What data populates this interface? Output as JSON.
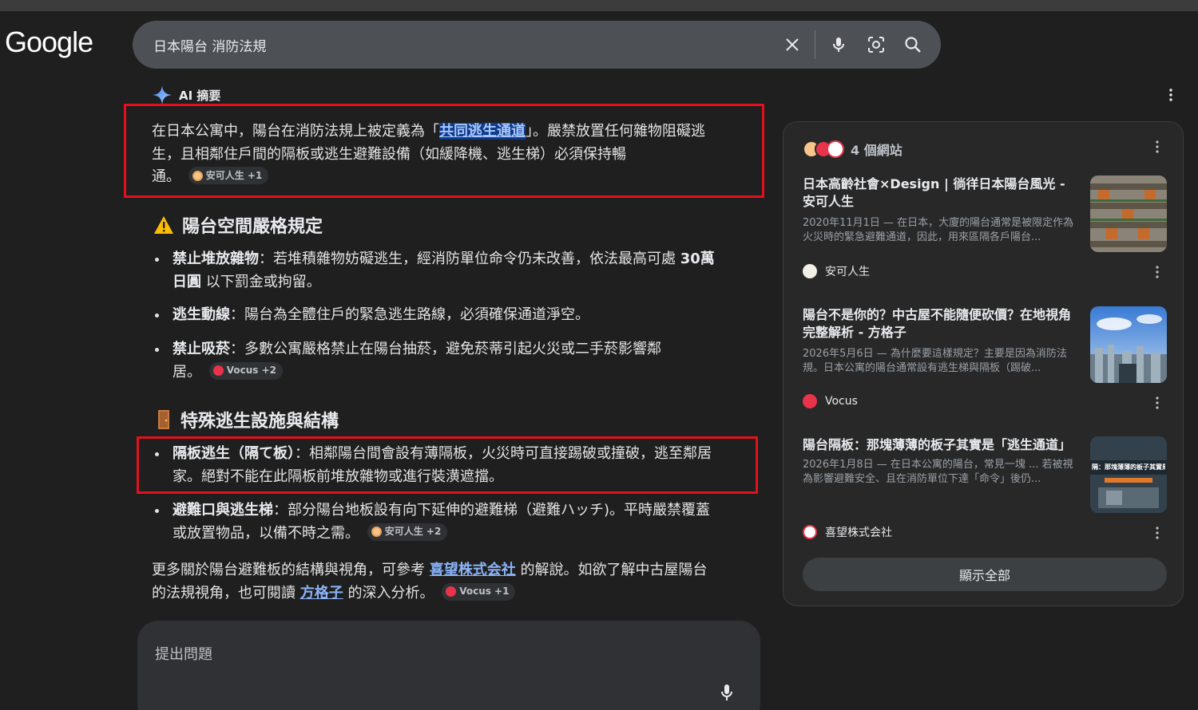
{
  "header": {
    "logo": "Google",
    "search_query": "日本陽台 消防法規"
  },
  "ai": {
    "label": "AI 摘要"
  },
  "intro": {
    "pre": "在日本公寓中，陽台在消防法規上被定義為「",
    "highlight": "共同逃生通道",
    "post1": "」。嚴禁放置任何雜物阻礙逃",
    "line2": "生，且相鄰住戶間的隔板或逃生避難設備（如緩降機、逃生梯）必須保持暢",
    "line3": "通。",
    "chip": "安可人生 +1"
  },
  "section1": {
    "title": "陽台空間嚴格規定",
    "items": [
      {
        "bold": "禁止堆放雜物",
        "text1": "：若堆積雜物妨礙逃生，經消防單位命令仍未改善，依法最高可處 ",
        "bold2": "30萬",
        "bold3": "日圓",
        "text2": " 以下罰金或拘留。"
      },
      {
        "bold": "逃生動線",
        "text": "：陽台為全體住戶的緊急逃生路線，必須確保通道淨空。"
      },
      {
        "bold": "禁止吸菸",
        "text1": "：多數公寓嚴格禁止在陽台抽菸，避免菸蒂引起火災或二手菸影響鄰",
        "text2": "居。",
        "chip": "Vocus +2"
      }
    ]
  },
  "section2": {
    "title": "特殊逃生設施與結構",
    "items": [
      {
        "bold": "隔板逃生（隔て板）",
        "text1": "：相鄰陽台間會設有薄隔板，火災時可直接踢破或撞破，逃至鄰居",
        "text2": "家。絕對不能在此隔板前堆放雜物或進行裝潢遮擋。"
      },
      {
        "bold": "避難口與逃生梯",
        "text1": "：部分陽台地板設有向下延伸的避難梯（避難ハッチ)。平時嚴禁覆蓋",
        "text2": "或放置物品，以備不時之需。",
        "chip": "安可人生 +2"
      }
    ]
  },
  "more": {
    "t1": "更多關於陽台避難板的結構與視角，可參考 ",
    "link1": "喜望株式会社",
    "t2": " 的解說。如欲了解中古屋陽台",
    "t3": "的法規視角，也可閱讀 ",
    "link2": "方格子",
    "t4": " 的深入分析。",
    "chip": "Vocus +1"
  },
  "ask": {
    "placeholder": "提出問題"
  },
  "sidebar": {
    "count": "4 個網站",
    "cards": [
      {
        "title": "日本高齡社會×Design | 徜徉日本陽台風光 - 安可人生",
        "snippet": "2020年11月1日 — 在日本，大廈的陽台通常是被限定作為火災時的緊急避難通道，因此，用來區隔各戶陽台...",
        "source": "安可人生"
      },
      {
        "title": "陽台不是你的？中古屋不能隨便砍價？在地視角完整解析 - 方格子",
        "snippet": "2026年5月6日 — 為什麼要這樣規定？主要是因為消防法規。日本公寓的陽台通常設有逃生梯與隔板（踢破...",
        "source": "Vocus"
      },
      {
        "title": "陽台隔板：那塊薄薄的板子其實是「逃生通道」",
        "snippet": "2026年1月8日 — 在日本公寓的陽台，常見一塊 ... 若被視為影響避難安全、且在消防單位下達「命令」後仍...",
        "source": "喜望株式会社",
        "thumb_text": "隔：那塊薄薄的板子其實是"
      }
    ],
    "show_all": "顯示全部"
  },
  "colors": {
    "background": "#1f1f1f",
    "highlight_box": "#e3101e",
    "link": "#8ab4f8"
  }
}
